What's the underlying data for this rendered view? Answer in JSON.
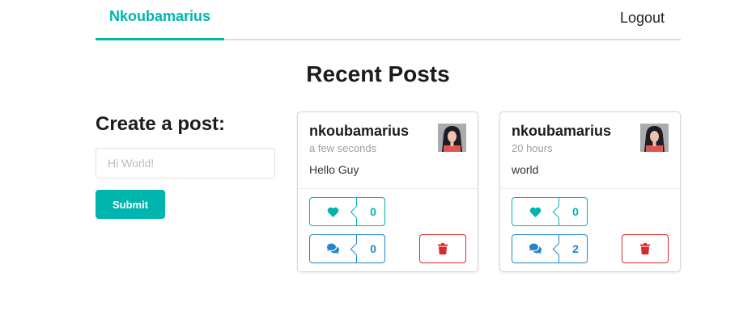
{
  "nav": {
    "brand": "Nkoubamarius",
    "logout_label": "Logout",
    "accent_color": "#00b5ad"
  },
  "page": {
    "title": "Recent Posts"
  },
  "create": {
    "title": "Create a post:",
    "placeholder": "Hi World!",
    "value": "",
    "submit_label": "Submit"
  },
  "posts": [
    {
      "author": "nkoubamarius",
      "time": "a few seconds",
      "body": "Hello Guy",
      "likes": "0",
      "comments": "0",
      "icons": [
        "heart-icon",
        "comments-icon",
        "trash-icon"
      ]
    },
    {
      "author": "nkoubamarius",
      "time": "20 hours",
      "body": "world",
      "likes": "0",
      "comments": "2",
      "icons": [
        "heart-icon",
        "comments-icon",
        "trash-icon"
      ]
    }
  ],
  "colors": {
    "like": "#00b5ad",
    "comment": "#2185d0",
    "delete": "#db2828"
  }
}
